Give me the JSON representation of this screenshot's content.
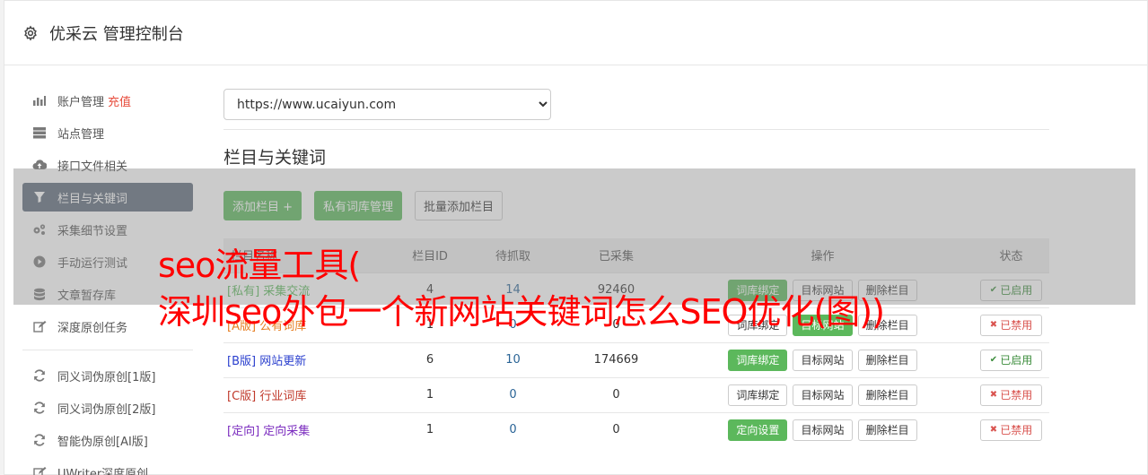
{
  "header": {
    "title": "优采云 管理控制台"
  },
  "sidebar": {
    "items": [
      {
        "label": "账户管理",
        "extra": "充值",
        "icon": "bar-chart-icon"
      },
      {
        "label": "站点管理",
        "icon": "server-icon"
      },
      {
        "label": "接口文件相关",
        "icon": "cloud-upload-icon"
      },
      {
        "label": "栏目与关键词",
        "icon": "filter-icon",
        "active": true
      },
      {
        "label": "采集细节设置",
        "icon": "gears-icon"
      },
      {
        "label": "手动运行测试",
        "icon": "play-circle-icon"
      },
      {
        "label": "文章暂存库",
        "icon": "database-icon"
      },
      {
        "label": "深度原创任务",
        "icon": "edit-icon"
      }
    ],
    "items2": [
      {
        "label": "同义词伪原创[1版]",
        "icon": "refresh-icon"
      },
      {
        "label": "同义词伪原创[2版]",
        "icon": "refresh-icon"
      },
      {
        "label": "智能伪原创[AI版]",
        "icon": "refresh-icon"
      },
      {
        "label": "UWriter深度原创",
        "icon": "edit-icon"
      }
    ]
  },
  "main": {
    "site_select": {
      "value": "https://www.ucaiyun.com",
      "options": [
        "https://www.ucaiyun.com"
      ]
    },
    "section_title": "栏目与关键词",
    "buttons": {
      "add": "添加栏目 +",
      "private": "私有词库管理",
      "batch": "批量添加栏目"
    },
    "table": {
      "headers": [
        "栏目名称",
        "栏目ID",
        "待抓取",
        "已采集",
        "操作",
        "状态"
      ],
      "rows": [
        {
          "tag": "[私有]",
          "name": "采集交流",
          "id": "4",
          "pending": "14",
          "collected": "92460",
          "op1": "词库绑定",
          "op1_green": true,
          "op2": "目标网站",
          "op2_green": false,
          "op3": "删除栏目",
          "status": "已启用",
          "on": true,
          "cls": "tag-priv"
        },
        {
          "tag": "[A版]",
          "name": "公有词库",
          "id": "1",
          "pending": "0",
          "collected": "0",
          "op1": "词库绑定",
          "op1_green": false,
          "op2": "目标网站",
          "op2_green": true,
          "op3": "删除栏目",
          "status": "已禁用",
          "on": false,
          "cls": "tag-a"
        },
        {
          "tag": "[B版]",
          "name": "网站更新",
          "id": "6",
          "pending": "10",
          "collected": "174669",
          "op1": "词库绑定",
          "op1_green": true,
          "op2": "目标网站",
          "op2_green": false,
          "op3": "删除栏目",
          "status": "已启用",
          "on": true,
          "cls": "tag-b"
        },
        {
          "tag": "[C版]",
          "name": "行业词库",
          "id": "1",
          "pending": "0",
          "collected": "0",
          "op1": "词库绑定",
          "op1_green": false,
          "op2": "目标网站",
          "op2_green": false,
          "op3": "删除栏目",
          "status": "已禁用",
          "on": false,
          "cls": "tag-c"
        },
        {
          "tag": "[定向]",
          "name": "定向采集",
          "id": "1",
          "pending": "0",
          "collected": "0",
          "op1": "定向设置",
          "op1_green": true,
          "op2": "目标网站",
          "op2_green": false,
          "op3": "删除栏目",
          "status": "已禁用",
          "on": false,
          "cls": "tag-d"
        }
      ]
    }
  },
  "overlay": {
    "line1": "seo流量工具(",
    "line2": "深圳seo外包一个新网站关键词怎么SEO优化(图))"
  },
  "colors": {
    "accent_green": "#5cb85c",
    "sidebar_active": "#5e6b7a",
    "overlay_text": "#ff0000",
    "danger": "#d9534f"
  }
}
